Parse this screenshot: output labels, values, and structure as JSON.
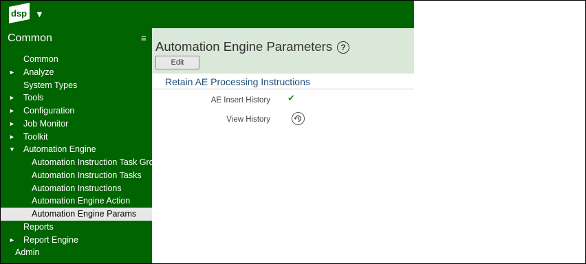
{
  "app": {
    "logo_text": "dsp"
  },
  "sidebar": {
    "title": "Common",
    "items": [
      {
        "label": "Common",
        "expander": "",
        "level": 0
      },
      {
        "label": "Analyze",
        "expander": "►",
        "level": 0
      },
      {
        "label": "System Types",
        "expander": "",
        "level": 0
      },
      {
        "label": "Tools",
        "expander": "►",
        "level": 0
      },
      {
        "label": "Configuration",
        "expander": "►",
        "level": 0
      },
      {
        "label": "Job Monitor",
        "expander": "►",
        "level": 0
      },
      {
        "label": "Toolkit",
        "expander": "►",
        "level": 0
      },
      {
        "label": "Automation Engine",
        "expander": "▼",
        "level": 0
      },
      {
        "label": "Automation Instruction Task Grou",
        "expander": "",
        "level": 1
      },
      {
        "label": "Automation Instruction Tasks",
        "expander": "",
        "level": 1
      },
      {
        "label": "Automation Instructions",
        "expander": "",
        "level": 1
      },
      {
        "label": "Automation Engine Action",
        "expander": "",
        "level": 1
      },
      {
        "label": "Automation Engine Params",
        "expander": "",
        "level": 1,
        "selected": true
      },
      {
        "label": "Reports",
        "expander": "",
        "level": 0
      },
      {
        "label": "Report Engine",
        "expander": "►",
        "level": 0
      },
      {
        "label": "Admin",
        "expander": "",
        "level": -1
      }
    ]
  },
  "main": {
    "title": "Automation Engine Parameters",
    "help_symbol": "?",
    "edit_label": "Edit",
    "section_title": "Retain AE Processing Instructions",
    "fields": [
      {
        "label": "AE Insert History",
        "value_icon": "checkmark-icon",
        "checked": true
      },
      {
        "label": "View History",
        "value_icon": "history-icon"
      }
    ]
  },
  "colors": {
    "brand_green": "#006400",
    "header_bg": "#d9e8d9",
    "section_title": "#1f4e79",
    "check_green": "#2e8b2e"
  }
}
